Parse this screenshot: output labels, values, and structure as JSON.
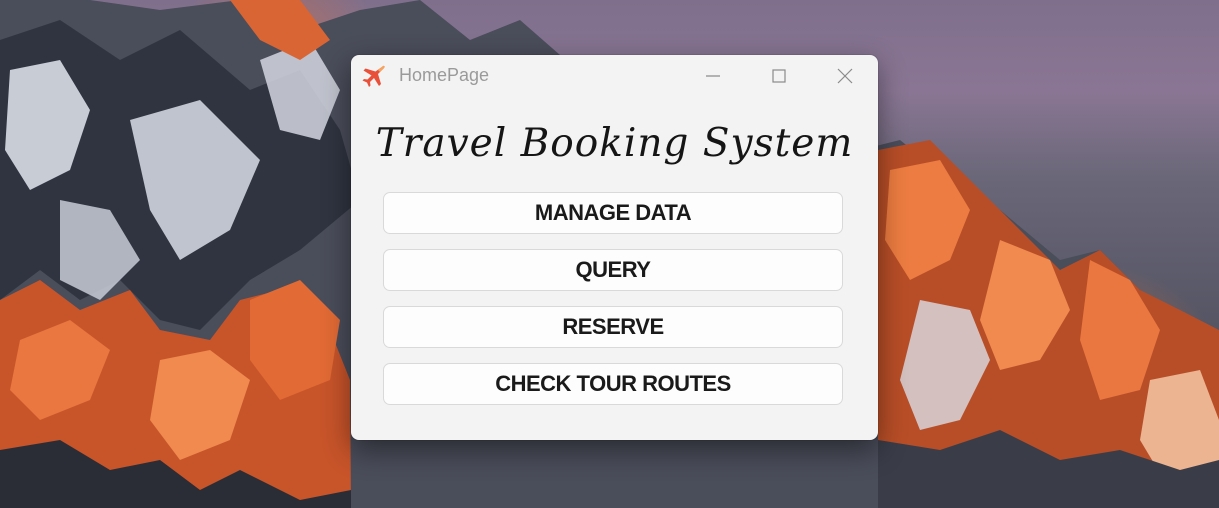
{
  "window": {
    "title": "HomePage",
    "controls": {
      "minimize_icon": "minimize-icon",
      "maximize_icon": "maximize-icon",
      "close_icon": "close-icon"
    }
  },
  "main": {
    "heading": "Travel Booking System",
    "buttons": [
      {
        "label": "MANAGE DATA"
      },
      {
        "label": "QUERY"
      },
      {
        "label": "RESERVE"
      },
      {
        "label": "CHECK TOUR ROUTES"
      }
    ]
  },
  "colors": {
    "window_bg": "#f3f3f3",
    "button_bg": "#fdfdfd",
    "button_border": "#d9d9d9",
    "app_icon": "#e8503a"
  }
}
